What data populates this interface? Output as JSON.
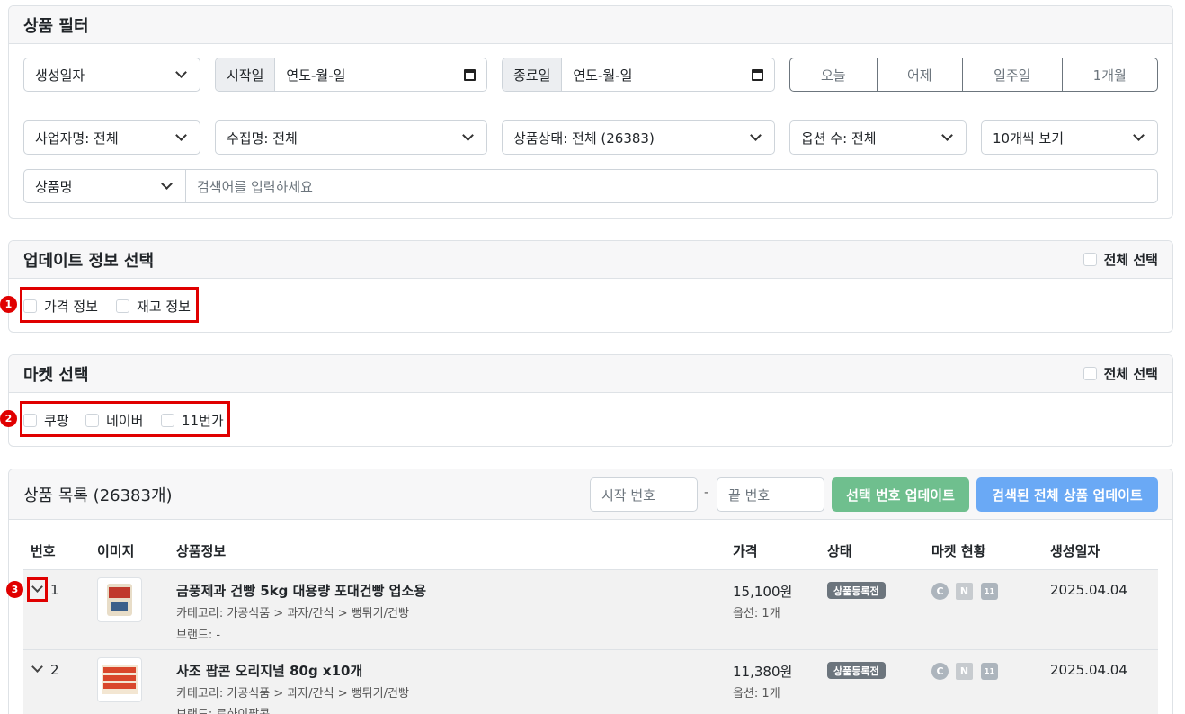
{
  "filter": {
    "title": "상품 필터",
    "date_type": "생성일자",
    "start_label": "시작일",
    "start_placeholder": "연도-월-일",
    "end_label": "종료일",
    "end_placeholder": "연도-월-일",
    "quick_ranges": [
      "오늘",
      "어제",
      "일주일",
      "1개월"
    ],
    "business": "사업자명: 전체",
    "collection": "수집명: 전체",
    "status": "상품상태: 전체 (26383)",
    "options": "옵션 수: 전체",
    "page_size": "10개씩 보기",
    "search_field": "상품명",
    "search_placeholder": "검색어를 입력하세요"
  },
  "update_info": {
    "title": "업데이트 정보 선택",
    "select_all": "전체 선택",
    "items": [
      "가격 정보",
      "재고 정보"
    ],
    "marker": "1"
  },
  "market": {
    "title": "마켓 선택",
    "select_all": "전체 선택",
    "items": [
      "쿠팡",
      "네이버",
      "11번가"
    ],
    "marker": "2"
  },
  "products": {
    "title": "상품 목록 (26383개)",
    "start_placeholder": "시작 번호",
    "range_sep": "-",
    "end_placeholder": "끝 번호",
    "update_selected": "선택 번호 업데이트",
    "update_all": "검색된 전체 상품 업데이트",
    "headers": [
      "번호",
      "이미지",
      "상품정보",
      "가격",
      "상태",
      "마켓 현황",
      "생성일자"
    ],
    "marker": "3",
    "rows": [
      {
        "no": "1",
        "name": "금풍제과 건빵 5kg 대용량 포대건빵 업소용",
        "category": "카테고리: 가공식품 > 과자/간식 > 뻥튀기/건빵",
        "brand": "브랜드: -",
        "price": "15,100원",
        "option": "옵션: 1개",
        "status": "상품등록전",
        "markets": [
          "C",
          "N",
          "11"
        ],
        "date": "2025.04.04"
      },
      {
        "no": "2",
        "name": "사조 팝콘 오리지널 80g x10개",
        "category": "카테고리: 가공식품 > 과자/간식 > 뻥튀기/건빵",
        "brand": "브랜드: 로하이팝콘",
        "price": "11,380원",
        "option": "옵션: 1개",
        "status": "상품등록전",
        "markets": [
          "C",
          "N",
          "11"
        ],
        "date": "2025.04.04"
      }
    ]
  },
  "colors": {
    "marker_red": "#e00000",
    "btn_green": "#6fbf8e",
    "btn_blue": "#6aa9f5",
    "status_gray": "#6c757d"
  }
}
